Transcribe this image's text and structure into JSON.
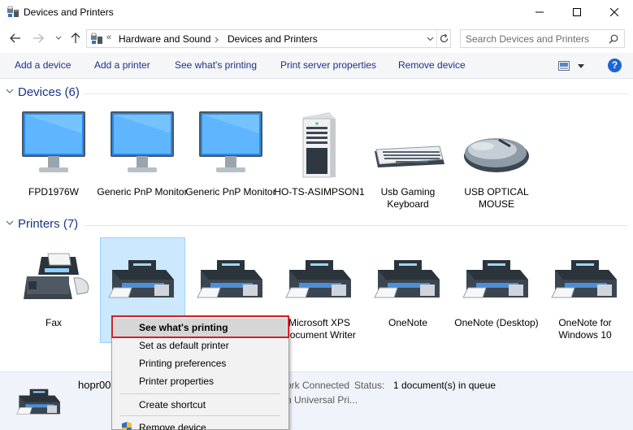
{
  "window": {
    "title": "Devices and Printers"
  },
  "nav": {
    "breadcrumb_overflow": "«",
    "breadcrumb": [
      "Hardware and Sound",
      "Devices and Printers"
    ],
    "search_placeholder": "Search Devices and Printers"
  },
  "toolbar": {
    "commands": [
      "Add a device",
      "Add a printer",
      "See what's printing",
      "Print server properties",
      "Remove device"
    ]
  },
  "devices_group": {
    "label": "Devices (6)"
  },
  "devices": [
    {
      "label": "FPD1976W",
      "icon": "monitor-icon"
    },
    {
      "label": "Generic PnP Monitor",
      "icon": "monitor-icon"
    },
    {
      "label": "Generic PnP Monitor",
      "icon": "monitor-icon"
    },
    {
      "label": "HO-TS-ASIMPSON1",
      "icon": "computer-tower-icon"
    },
    {
      "label": "Usb Gaming Keyboard",
      "icon": "keyboard-icon"
    },
    {
      "label": "USB OPTICAL MOUSE",
      "icon": "mouse-icon"
    }
  ],
  "printers_group": {
    "label": "Printers (7)"
  },
  "printers": [
    {
      "label": "Fax",
      "icon": "fax-icon"
    },
    {
      "label": "hopr00",
      "icon": "printer-icon",
      "selected": true
    },
    {
      "label": "",
      "icon": "printer-icon"
    },
    {
      "label": "Microsoft XPS Document Writer",
      "icon": "printer-icon"
    },
    {
      "label": "OneNote",
      "icon": "printer-icon"
    },
    {
      "label": "OneNote (Desktop)",
      "icon": "printer-icon"
    },
    {
      "label": "OneNote for Windows 10",
      "icon": "printer-icon"
    }
  ],
  "details": {
    "name": "hopr00",
    "state_fragment": "ork Connected",
    "status_label": "Status:",
    "status_value": "1 document(s) in queue",
    "model_fragment": "n Universal Pri..."
  },
  "context_menu": {
    "items": [
      {
        "label": "See what's printing",
        "default": true,
        "highlighted": true
      },
      {
        "label": "Set as default printer"
      },
      {
        "label": "Printing preferences"
      },
      {
        "label": "Printer properties"
      },
      {
        "label": "Create shortcut"
      },
      {
        "label": "Remove device",
        "icon": "shield-icon"
      }
    ]
  },
  "colors": {
    "link": "#1e3287",
    "selection": "#cce8ff",
    "annotation": "#d0202a",
    "details_bg": "#f0f3f9"
  }
}
